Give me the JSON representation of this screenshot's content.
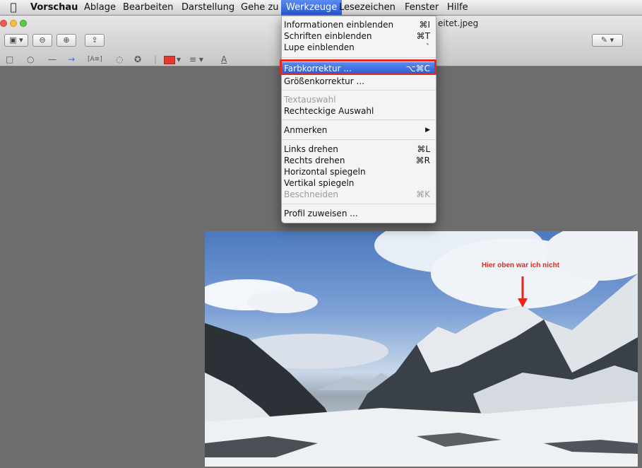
{
  "menubar": {
    "apple": "",
    "items": [
      "Vorschau",
      "Ablage",
      "Bearbeiten",
      "Darstellung",
      "Gehe zu",
      "Werkzeuge",
      "Lesezeichen",
      "Fenster",
      "Hilfe"
    ]
  },
  "window": {
    "title": "eitet.jpeg"
  },
  "toolbar": {
    "sidebar_icon": "▣ ▾",
    "zoom_out_icon": "⊖",
    "zoom_in_icon": "⊕",
    "share_icon": "⇪",
    "pen_icon": "✎ ▾"
  },
  "annotations": {
    "rect": "□",
    "oval": "○",
    "line": "—",
    "arrow": "→",
    "text": "[A≡]",
    "speech": "◌",
    "shape": "✪",
    "color": "▾",
    "lines": "≡ ▾",
    "font": "A"
  },
  "menu": {
    "items": [
      {
        "label": "Informationen einblenden",
        "shortcut": "⌘I"
      },
      {
        "label": "Schriften einblenden",
        "shortcut": "⌘T"
      },
      {
        "label": "Lupe einblenden",
        "shortcut": "`"
      },
      {
        "label": "Farbkorrektur ...",
        "shortcut": "⌥⌘C"
      },
      {
        "label": "Größenkorrektur ...",
        "shortcut": ""
      },
      {
        "label": "Textauswahl",
        "shortcut": ""
      },
      {
        "label": "Rechteckige Auswahl",
        "shortcut": ""
      },
      {
        "label": "Anmerken",
        "shortcut": "▶"
      },
      {
        "label": "Links drehen",
        "shortcut": "⌘L"
      },
      {
        "label": "Rechts drehen",
        "shortcut": "⌘R"
      },
      {
        "label": "Horizontal spiegeln",
        "shortcut": ""
      },
      {
        "label": "Vertikal spiegeln",
        "shortcut": ""
      },
      {
        "label": "Beschneiden",
        "shortcut": "⌘K"
      },
      {
        "label": "Profil zuweisen ...",
        "shortcut": ""
      }
    ]
  },
  "photo": {
    "caption": "Hier oben war ich nicht"
  },
  "colors": {
    "highlight": "#e3281c",
    "menu_selection": "#2f63d8",
    "annotation_red": "#e8261a"
  }
}
